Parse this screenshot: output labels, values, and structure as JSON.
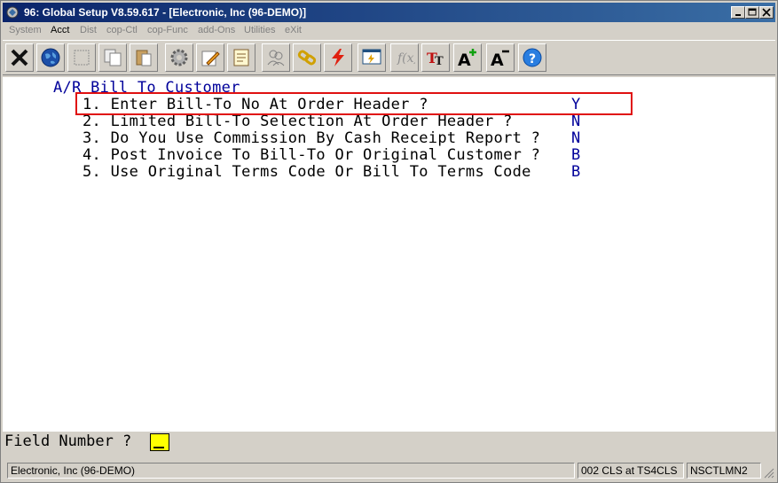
{
  "window": {
    "title": "96: Global Setup V8.59.617 - [Electronic, Inc (96-DEMO)]"
  },
  "menu": {
    "items": [
      {
        "label": "System",
        "active": false
      },
      {
        "label": "Acct",
        "active": true
      },
      {
        "label": "Dist",
        "active": false
      },
      {
        "label": "cop-Ctl",
        "active": false
      },
      {
        "label": "cop-Func",
        "active": false
      },
      {
        "label": "add-Ons",
        "active": false
      },
      {
        "label": "Utilities",
        "active": false
      },
      {
        "label": "eXit",
        "active": false
      }
    ]
  },
  "toolbar": {
    "icons": [
      "close-x-icon",
      "globe-icon",
      "blank-window-icon",
      "copy-icon",
      "paste-icon",
      "settings-gear-icon",
      "edit-pencil-icon",
      "notes-icon",
      "users-icon",
      "link-icon",
      "lightning-icon",
      "screen-edit-icon",
      "function-icon",
      "text-format-icon",
      "font-larger-icon",
      "font-smaller-icon",
      "help-icon"
    ]
  },
  "screen": {
    "heading": "A/R Bill To Customer",
    "options": [
      {
        "text": "1. Enter Bill-To No At Order Header ?",
        "value": "Y"
      },
      {
        "text": "2. Limited Bill-To Selection At Order Header ?",
        "value": "N"
      },
      {
        "text": "3. Do You Use Commission By Cash Receipt Report ?",
        "value": "N"
      },
      {
        "text": "4. Post Invoice To Bill-To Or Original Customer ?",
        "value": "B"
      },
      {
        "text": "5. Use Original Terms Code Or Bill To Terms Code",
        "value": "B"
      }
    ]
  },
  "prompt": {
    "label": "Field Number ?",
    "value": ""
  },
  "status": {
    "company": "Electronic, Inc (96-DEMO)",
    "session": "002 CLS at TS4CLS",
    "program": "NSCTLMN2"
  },
  "colors": {
    "answer": "#00009a",
    "highlight_border": "#e01010",
    "input_field": "#ffff00"
  }
}
